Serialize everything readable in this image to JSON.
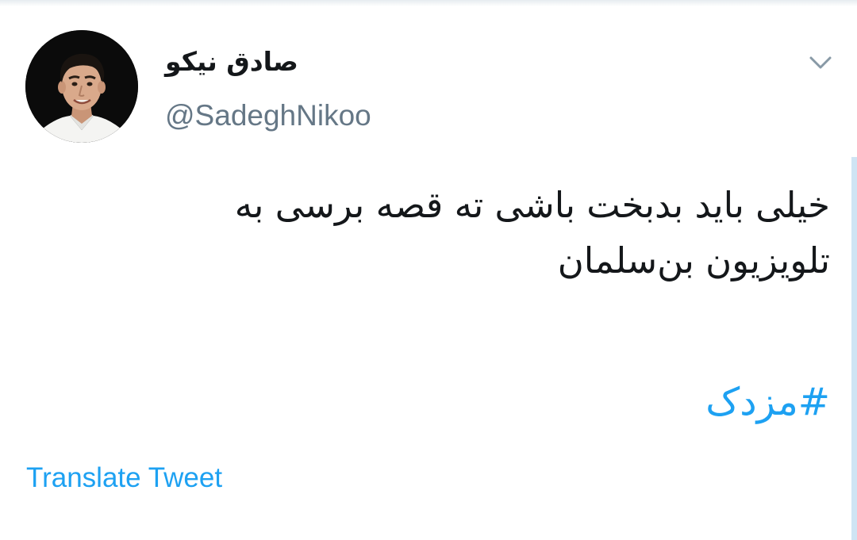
{
  "tweet": {
    "author": {
      "display_name": "صادق نیکو",
      "handle": "@SadeghNikoo"
    },
    "text_lines": [
      "خیلی باید بدبخت باشی ته قصه برسی به",
      "تلویزیون بن‌سلمان"
    ],
    "hashtag": "#مزدک",
    "translate_label": "Translate Tweet"
  },
  "icons": {
    "menu_caret": "chevron-down-icon",
    "avatar": "profile-photo"
  },
  "colors": {
    "text": "#14171a",
    "muted": "#657786",
    "link": "#1da1f2",
    "avatar_bg": "#0b0b0b"
  }
}
